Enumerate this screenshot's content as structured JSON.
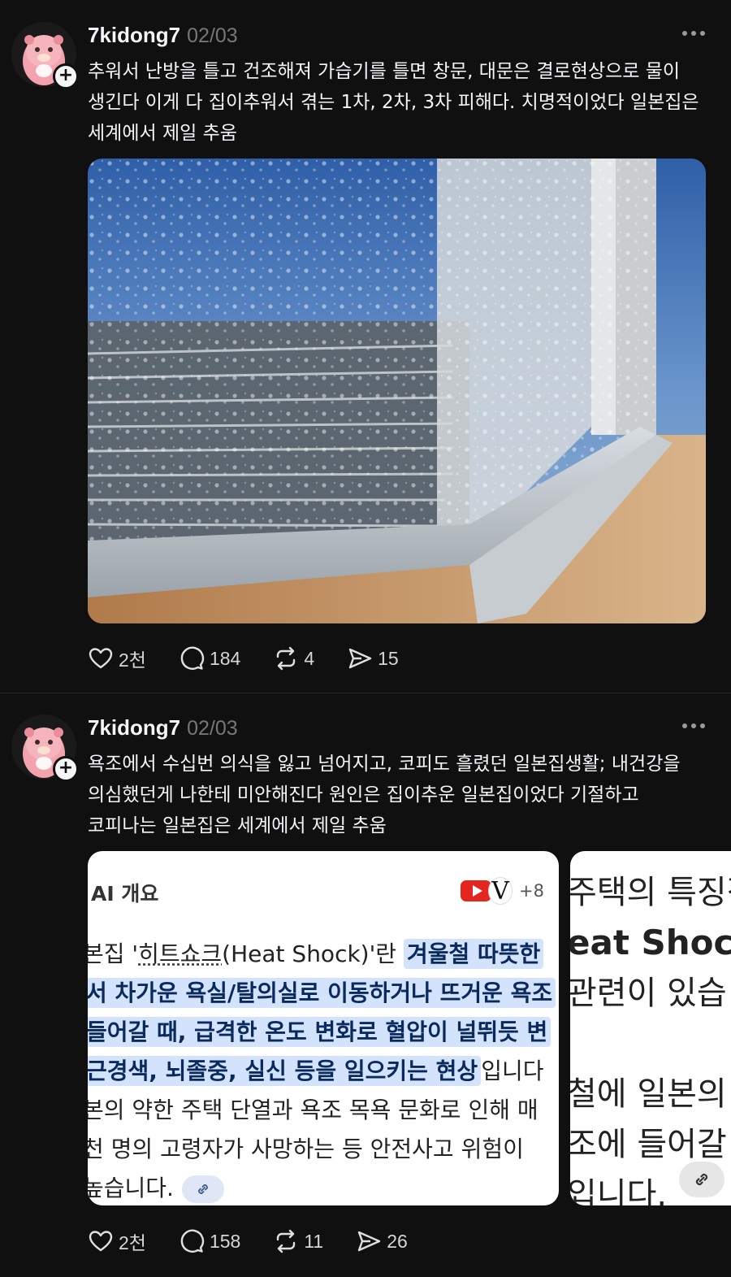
{
  "posts": [
    {
      "username": "7kidong7",
      "date": "02/03",
      "caption": "추워서 난방을 틀고 건조해져 가습기를 틀면 창문, 대문은 결로현상으로 물이\n생긴다 이게 다 집이추워서 겪는 1차, 2차, 3차 피해다. 치명적이었다 일본집은\n세계에서 제일 추움",
      "stats": {
        "likes": "2천",
        "comments": "184",
        "reposts": "4",
        "shares": "15"
      }
    },
    {
      "username": "7kidong7",
      "date": "02/03",
      "caption": "욕조에서 수십번 의식을 잃고 넘어지고, 코피도 흘렸던 일본집생활; 내건강을\n의심했던게 나한테 미안해진다 원인은 집이추운 일본집이었다 기절하고\n코피나는 일본집은 세계에서 제일 추움",
      "stats": {
        "likes": "2천",
        "comments": "158",
        "reposts": "11",
        "shares": "26"
      }
    }
  ],
  "card1": {
    "heading": "AI 개요",
    "sources_more": "+8",
    "line1_a": "본집 '",
    "line1_term": "히트쇼크",
    "line1_b": "(Heat Shock)'란 ",
    "line1_hl": "겨울철 따뜻한",
    "line2_hl": "서 차가운 욕실/탈의실로 이동하거나 뜨거운 욕조",
    "line3_hl": "들어갈 때, 급격한 온도 변화로 혈압이 널뛰듯 변",
    "line4_hl": "근경색, 뇌졸중, 실신 등을 일으키는 현상",
    "line4_b": "입니다",
    "line5": "본의 약한 주택 단열과 욕조 목욕 문화로 인해 매",
    "line6": "천 명의 고령자가 사망하는 등 안전사고 위험이",
    "line7": "높습니다."
  },
  "card2": {
    "line1": "주택의 특징적",
    "line2": "eat Shock",
    "line3": "관련이 있습",
    "line4": "",
    "line5": "철에 일본의",
    "line6": "조에 들어갈",
    "line7": "입니다."
  }
}
